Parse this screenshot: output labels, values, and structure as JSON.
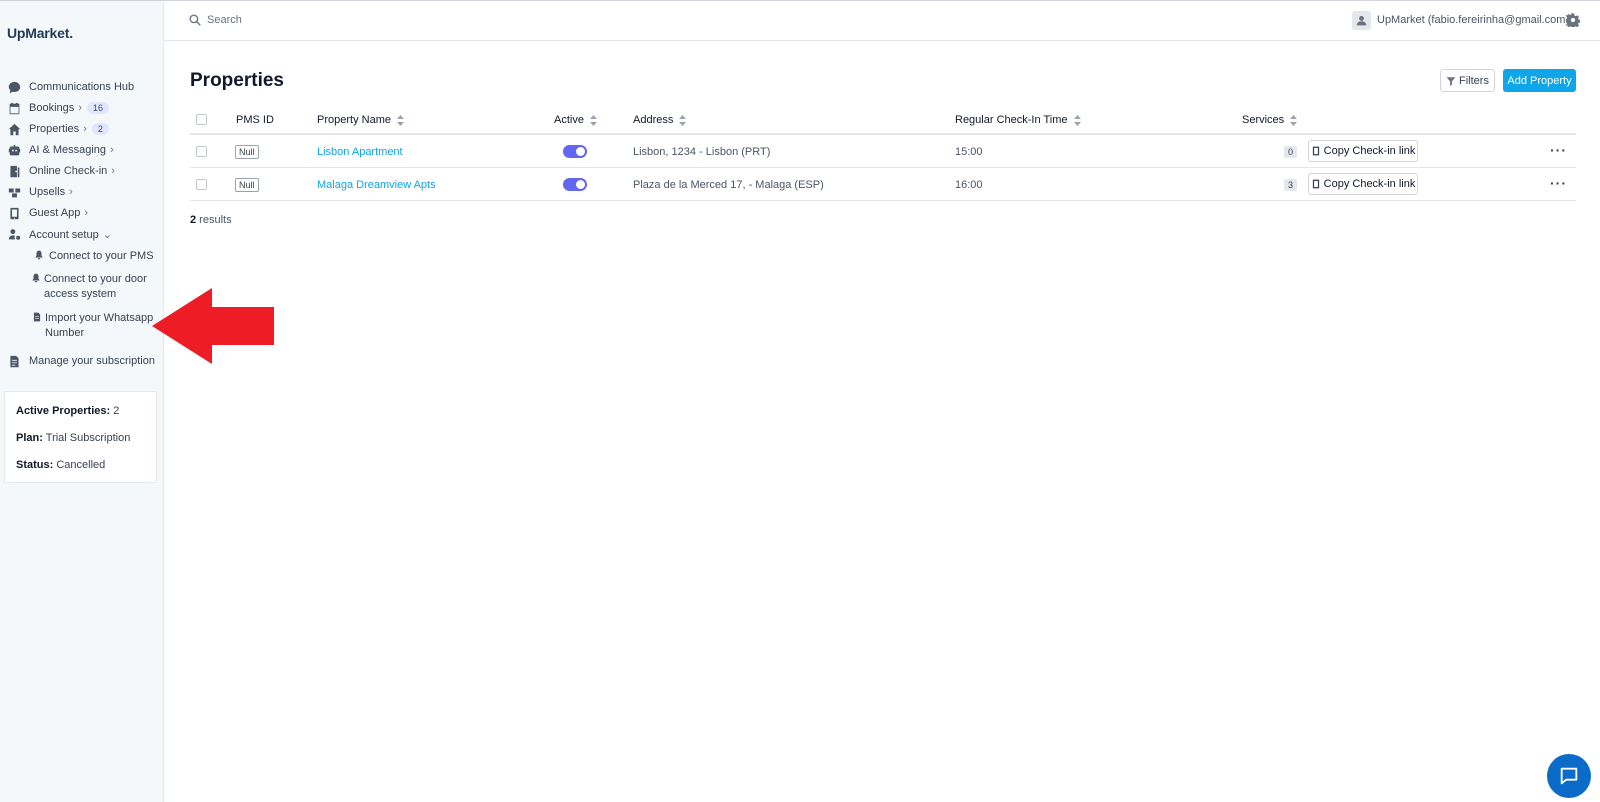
{
  "app": {
    "logo": "UpMarket."
  },
  "sidebar": {
    "items": [
      {
        "label": "Communications Hub",
        "icon": "chat-bubble-icon"
      },
      {
        "label": "Bookings",
        "icon": "calendar-icon",
        "badge": "16",
        "chevron": "›"
      },
      {
        "label": "Properties",
        "icon": "home-icon",
        "badge": "2",
        "chevron": "›"
      },
      {
        "label": "AI & Messaging",
        "icon": "robot-icon",
        "chevron": "›"
      },
      {
        "label": "Online Check-in",
        "icon": "door-icon",
        "chevron": "›"
      },
      {
        "label": "Upsells",
        "icon": "boxes-icon",
        "chevron": "›"
      },
      {
        "label": "Guest App",
        "icon": "mobile-icon",
        "chevron": "›"
      },
      {
        "label": "Account setup",
        "icon": "user-cog-icon",
        "chevron": "⌄"
      },
      {
        "label": "Manage your subscription",
        "icon": "document-icon"
      }
    ],
    "subitems": [
      {
        "label": "Connect to your PMS",
        "icon": "bell-icon"
      },
      {
        "label_line1": "Connect to your door",
        "label_line2": "access system",
        "icon": "bell-icon"
      },
      {
        "label_line1": "Import your Whatsapp",
        "label_line2": "Number",
        "icon": "file-icon"
      }
    ],
    "plan_card": {
      "active_label": "Active Properties:",
      "active_value": " 2",
      "plan_label": "Plan:",
      "plan_value": " Trial Subscription",
      "status_label": "Status:",
      "status_value": " Cancelled"
    }
  },
  "topbar": {
    "search_placeholder": "Search",
    "user": "UpMarket (fabio.fereirinha@gmail.com)"
  },
  "main": {
    "title": "Properties",
    "filters_label": "Filters",
    "add_label": "Add Property",
    "columns": {
      "pms_id": "PMS ID",
      "name": "Property Name",
      "active": "Active",
      "address": "Address",
      "checkin": "Regular Check-In Time",
      "services": "Services"
    },
    "rows": [
      {
        "pms_id": "Null",
        "name": "Lisbon Apartment",
        "active": true,
        "address": "Lisbon, 1234 - Lisbon (PRT)",
        "checkin": "15:00",
        "services": "0",
        "action": "Copy Check-in link"
      },
      {
        "pms_id": "Null",
        "name": "Malaga Dreamview Apts",
        "active": true,
        "address": "Plaza de la Merced 17, - Malaga (ESP)",
        "checkin": "16:00",
        "services": "3",
        "action": "Copy Check-in link"
      }
    ],
    "results_count": "2",
    "results_label": " results"
  },
  "colors": {
    "accent": "#0ea5e9",
    "toggle": "#6366f1",
    "arrow": "#ee1c25",
    "chat": "#0b6bc9"
  }
}
